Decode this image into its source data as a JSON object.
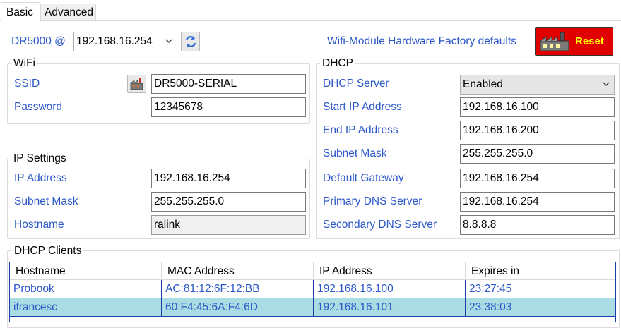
{
  "tabs": [
    {
      "label": "Basic",
      "active": true
    },
    {
      "label": "Advanced",
      "active": false
    }
  ],
  "device": {
    "prefix": "DR5000 @",
    "selected_ip": "192.168.16.254",
    "factory_defaults_text": "Wifi-Module Hardware Factory defaults",
    "reset_label": "Reset"
  },
  "wifi": {
    "title": "WiFi",
    "ssid_label": "SSID",
    "ssid_value": "DR5000-SERIAL",
    "password_label": "Password",
    "password_value": "12345678"
  },
  "ip_settings": {
    "title": "IP Settings",
    "ip_label": "IP Address",
    "ip_value": "192.168.16.254",
    "mask_label": "Subnet Mask",
    "mask_value": "255.255.255.0",
    "hostname_label": "Hostname",
    "hostname_value": "ralink"
  },
  "dhcp": {
    "title": "DHCP",
    "server_label": "DHCP Server",
    "server_value": "Enabled",
    "start_label": "Start IP Address",
    "start_value": "192.168.16.100",
    "end_label": "End IP Address",
    "end_value": "192.168.16.200",
    "mask_label": "Subnet Mask",
    "mask_value": "255.255.255.0",
    "gateway_label": "Default Gateway",
    "gateway_value": "192.168.16.254",
    "dns1_label": "Primary DNS Server",
    "dns1_value": "192.168.16.254",
    "dns2_label": "Secondary DNS Server",
    "dns2_value": "8.8.8.8"
  },
  "clients": {
    "title": "DHCP Clients",
    "columns": [
      "Hostname",
      "MAC Address",
      "IP Address",
      "Expires in"
    ],
    "rows": [
      [
        "Probook",
        "AC:81:12:6F:12:BB",
        "192.168.16.100",
        "23:27:45"
      ],
      [
        "ifrancesc",
        "60:F4:45:6A:F4:6D",
        "192.168.16.101",
        "23:38:03"
      ]
    ]
  },
  "colors": {
    "label_blue": "#2b57c8",
    "reset_red": "#e10000",
    "reset_text": "#ffff00",
    "selected_row": "#aadde3"
  },
  "icons": {
    "refresh": "refresh-icon",
    "ssid_scan": "factory-icon",
    "reset": "factory-icon"
  }
}
